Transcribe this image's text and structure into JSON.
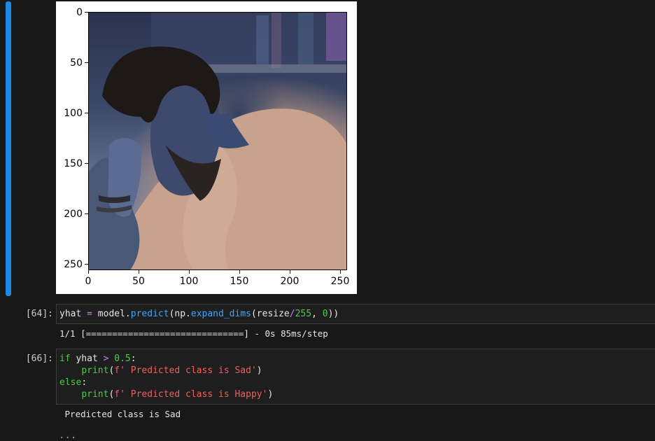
{
  "cells": {
    "c64": {
      "prompt": "[64]:",
      "code": {
        "t1": "yhat ",
        "op1": "=",
        "t2": " model.",
        "fn1": "predict",
        "t3": "(np.",
        "fn2": "expand_dims",
        "t4": "(resize",
        "op2": "/",
        "num1": "255",
        "t5": ", ",
        "num2": "0",
        "t6": "))"
      },
      "output": "1/1 [==============================] - 0s 85ms/step"
    },
    "c66": {
      "prompt": "[66]:",
      "code": {
        "kw_if": "if",
        "t1": " yhat ",
        "op1": ">",
        "t2": " ",
        "num1": "0.5",
        "t3": ":",
        "indent": "    ",
        "kw_print1": "print",
        "p1_open": "(",
        "s1": "f' Predicted class is Sad'",
        "p1_close": ")",
        "kw_else": "else",
        "t4": ":",
        "kw_print2": "print",
        "p2_open": "(",
        "s2": "f' Predicted class is Happy'",
        "p2_close": ")"
      },
      "output": " Predicted class is Sad"
    }
  },
  "figure": {
    "y_ticks": [
      "0",
      "50",
      "100",
      "150",
      "200",
      "250"
    ],
    "x_ticks": [
      "0",
      "50",
      "100",
      "150",
      "200",
      "250"
    ]
  },
  "collapsed_marker": "...",
  "colors": {
    "active_cell_bar": "#1e88e5",
    "keyword": "#4ec94e",
    "function": "#3ea6ff",
    "operator": "#c67ef7",
    "string": "#f25e5e"
  }
}
